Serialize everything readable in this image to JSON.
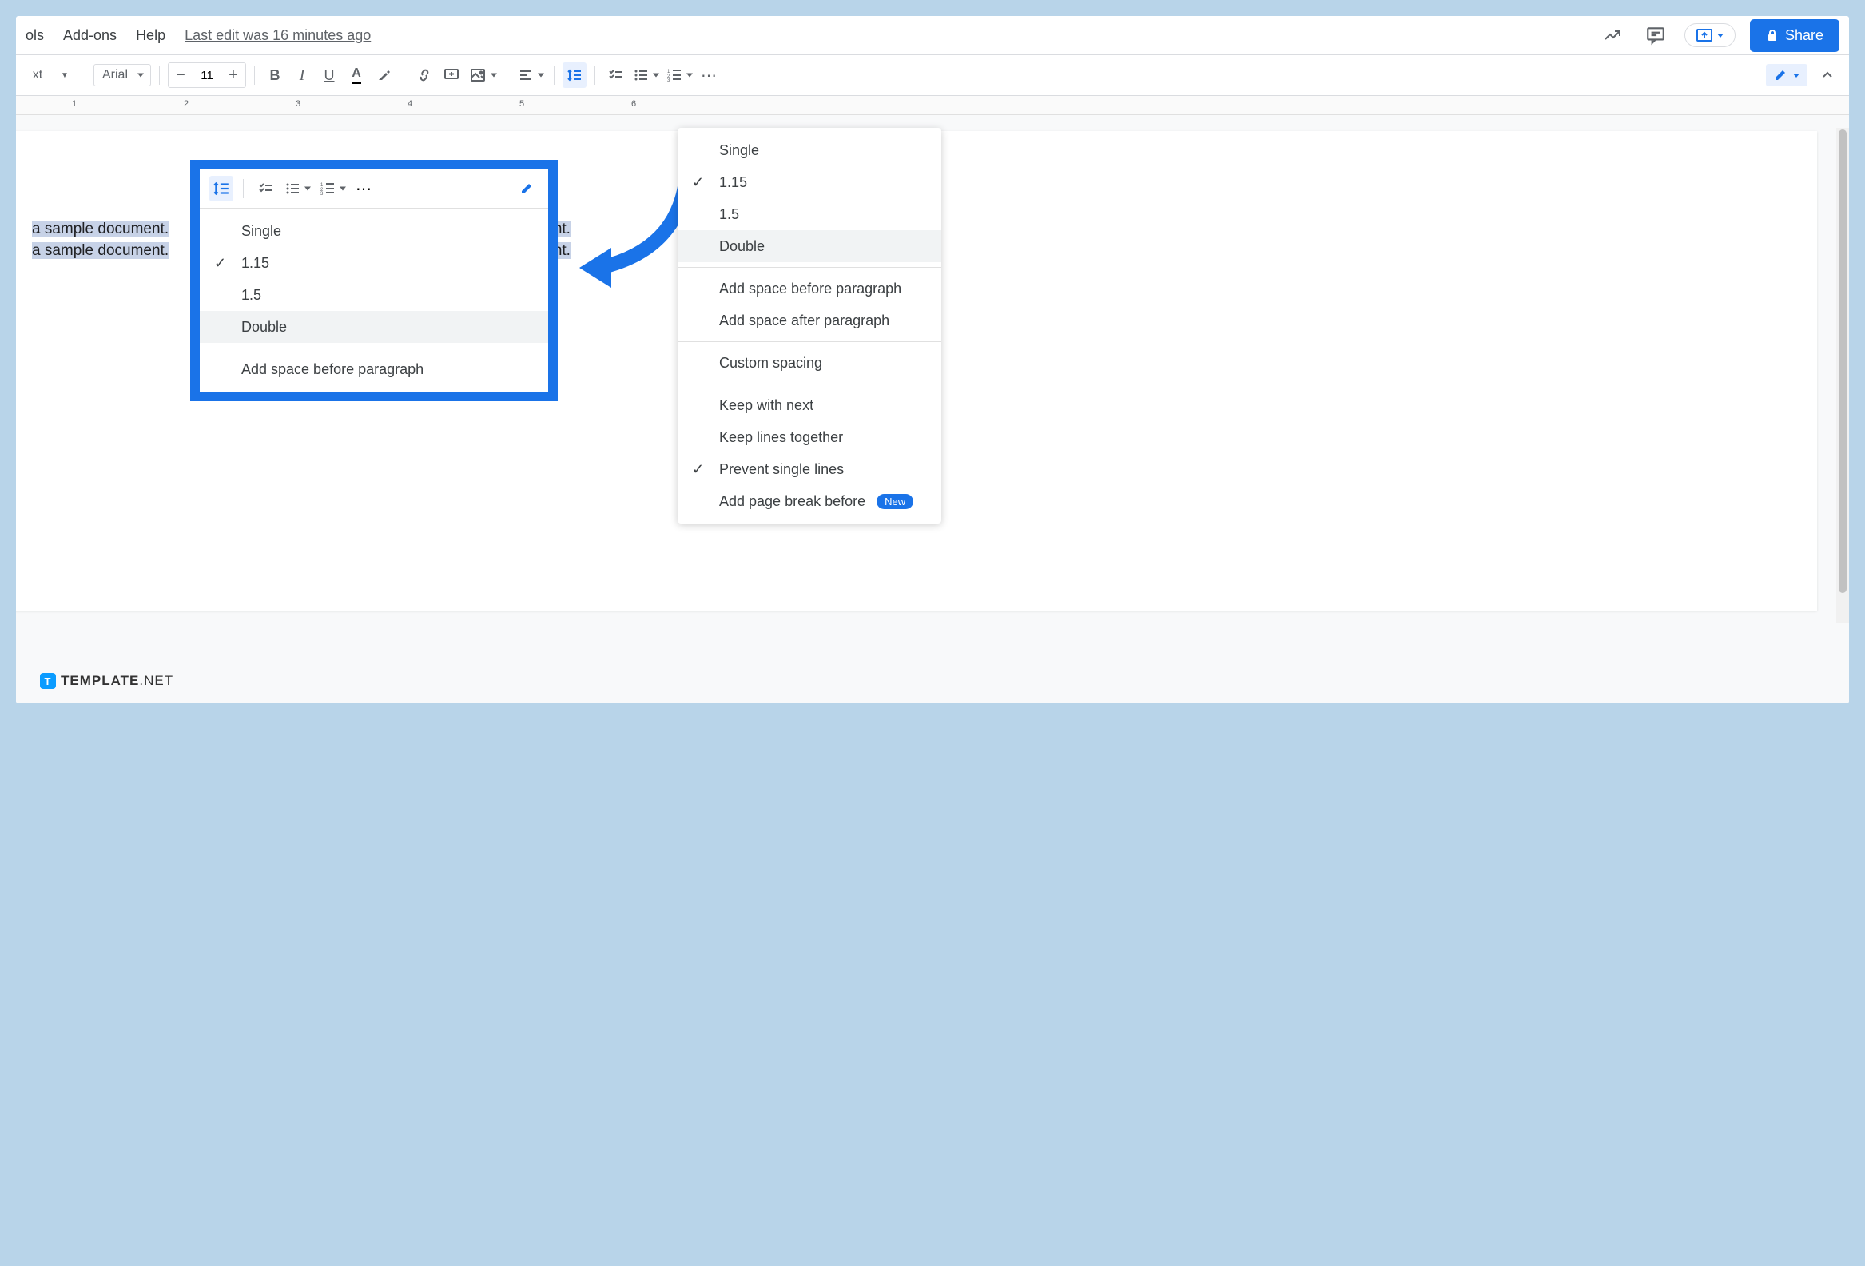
{
  "menubar": {
    "tools": "ols",
    "addons": "Add-ons",
    "help": "Help",
    "last_edit": "Last edit was 16 minutes ago",
    "share": "Share"
  },
  "toolbar": {
    "style_suffix": "xt",
    "font": "Arial",
    "size": "11"
  },
  "ruler": {
    "t1": "1",
    "t2": "2",
    "t3": "3",
    "t4": "4",
    "t5": "5",
    "t6": "6"
  },
  "doc": {
    "line1a": "a sample document.",
    "line1b": "cument.",
    "line2a": "a sample document.",
    "line2b": "cument."
  },
  "spacing_menu": {
    "single": "Single",
    "v115": "1.15",
    "v15": "1.5",
    "double": "Double",
    "add_before": "Add space before paragraph",
    "add_after": "Add space after paragraph",
    "custom": "Custom spacing",
    "keep_next": "Keep with next",
    "keep_lines": "Keep lines together",
    "prevent_single": "Prevent single lines",
    "page_break": "Add page break before",
    "new_badge": "New"
  },
  "callout_menu": {
    "single": "Single",
    "v115": "1.15",
    "v15": "1.5",
    "double": "Double",
    "add_before": "Add space before paragraph"
  },
  "watermark": {
    "t": "T",
    "template": "TEMPLATE",
    "net": ".NET"
  }
}
